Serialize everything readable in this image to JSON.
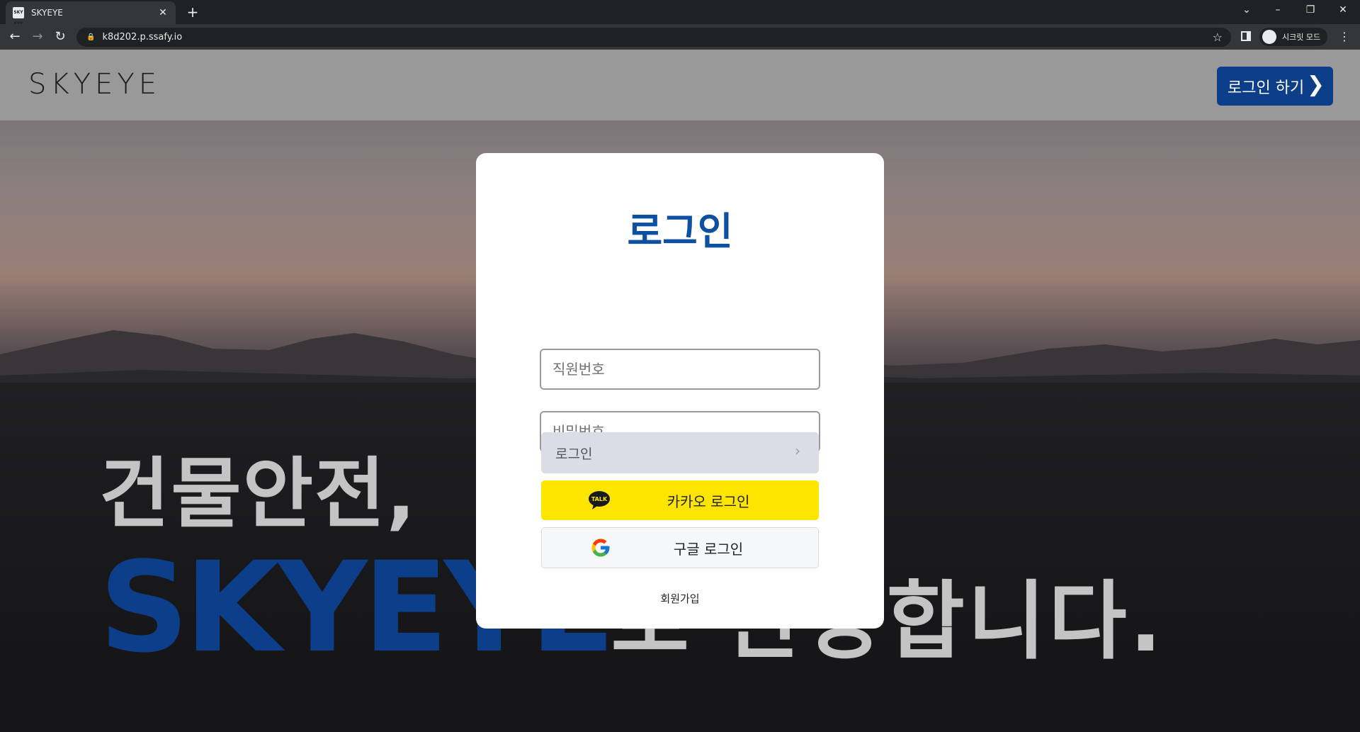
{
  "browser": {
    "tab_title": "SKYEYE",
    "favicon_text": "SKY EYE",
    "tab_close": "✕",
    "new_tab": "+",
    "url": "k8d202.p.ssafy.io",
    "incognito_label": "시크릿 모드",
    "icons": [
      "back-icon",
      "forward-icon",
      "reload-icon",
      "lock-icon",
      "star-icon",
      "side-panel-icon",
      "incognito-icon",
      "menu-icon",
      "minimize-icon",
      "restore-icon",
      "close-icon",
      "tab-search-icon"
    ]
  },
  "header": {
    "logo": "SKYEYE",
    "login_button": "로그인 하기",
    "login_chevron": "❯",
    "accent_color": "#0d3e8a"
  },
  "hero": {
    "line1": "건물안전,",
    "brand": "SKYEYE",
    "line2_rest": "로 관장합니다."
  },
  "modal": {
    "title": "로그인",
    "employee_id_placeholder": "직원번호",
    "password_placeholder": "비밀번호",
    "login_button": "로그인",
    "login_chevron": "›",
    "kakao_button": "카카오 로그인",
    "kakao_icon_text": "TALK",
    "google_button": "구글 로그인",
    "signup_link": "회원가입",
    "colors": {
      "title": "#0d4fa0",
      "kakao": "#fee500",
      "login_button_bg": "#dadde6"
    }
  }
}
